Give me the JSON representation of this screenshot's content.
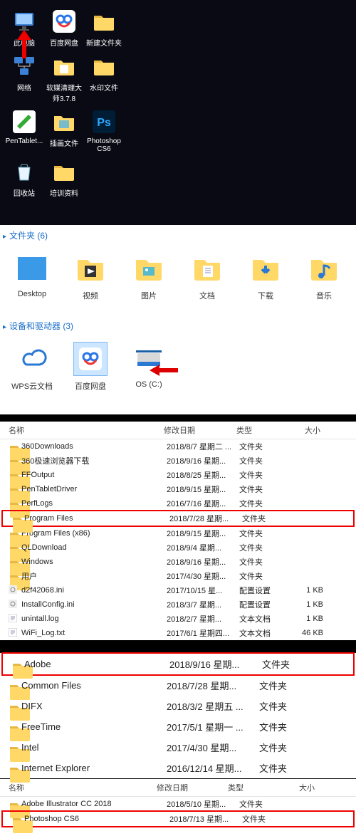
{
  "desktop": {
    "rows": [
      [
        {
          "label": "此电脑",
          "icon": "monitor",
          "name": "desktop-icon-this-pc"
        },
        {
          "label": "百度网盘",
          "icon": "baidu",
          "name": "desktop-icon-baidu-netdisk"
        },
        {
          "label": "新建文件夹",
          "icon": "folder",
          "name": "desktop-icon-new-folder"
        }
      ],
      [
        {
          "label": "网络",
          "icon": "network",
          "name": "desktop-icon-network"
        },
        {
          "label": "软媒清理大师3.7.8",
          "icon": "folder-doc",
          "name": "desktop-icon-cleaner"
        },
        {
          "label": "水印文件",
          "icon": "folder",
          "name": "desktop-icon-watermark"
        }
      ],
      [
        {
          "label": "PenTablet...",
          "icon": "app-green",
          "name": "desktop-icon-pentablet"
        },
        {
          "label": "插画文件",
          "icon": "folder-pic",
          "name": "desktop-icon-illustration"
        },
        {
          "label": "Photoshop CS6",
          "icon": "ps",
          "name": "desktop-icon-photoshop"
        }
      ],
      [
        {
          "label": "回收站",
          "icon": "recycle",
          "name": "desktop-icon-recycle-bin"
        },
        {
          "label": "培训资料",
          "icon": "folder",
          "name": "desktop-icon-training"
        }
      ]
    ]
  },
  "folders_section": {
    "title": "文件夹 (6)",
    "items": [
      {
        "label": "Desktop",
        "icon": "desktop-tile",
        "name": "library-desktop"
      },
      {
        "label": "视频",
        "icon": "video",
        "name": "library-videos"
      },
      {
        "label": "图片",
        "icon": "pictures",
        "name": "library-pictures"
      },
      {
        "label": "文档",
        "icon": "documents",
        "name": "library-documents"
      },
      {
        "label": "下载",
        "icon": "downloads",
        "name": "library-downloads"
      },
      {
        "label": "音乐",
        "icon": "music",
        "name": "library-music"
      }
    ]
  },
  "drives_section": {
    "title": "设备和驱动器 (3)",
    "items": [
      {
        "label": "WPS云文档",
        "icon": "wps-cloud",
        "name": "drive-wps-cloud"
      },
      {
        "label": "百度网盘",
        "icon": "baidu",
        "name": "drive-baidu",
        "selected": true
      },
      {
        "label": "OS (C:)",
        "icon": "hdd",
        "name": "drive-os-c"
      }
    ]
  },
  "table1": {
    "headers": {
      "name": "名称",
      "date": "修改日期",
      "type": "类型",
      "size": "大小"
    },
    "rows": [
      {
        "name": "360Downloads",
        "date": "2018/8/7 星期二 ...",
        "type": "文件夹",
        "size": "",
        "icon": "folder",
        "dn": "row-360downloads"
      },
      {
        "name": "360极速浏览器下载",
        "date": "2018/9/16 星期...",
        "type": "文件夹",
        "size": "",
        "icon": "folder",
        "dn": "row-360browser"
      },
      {
        "name": "FFOutput",
        "date": "2018/8/25 星期...",
        "type": "文件夹",
        "size": "",
        "icon": "folder",
        "dn": "row-ffoutput"
      },
      {
        "name": "PenTabletDriver",
        "date": "2018/9/15 星期...",
        "type": "文件夹",
        "size": "",
        "icon": "folder",
        "dn": "row-pentabletdriver"
      },
      {
        "name": "PerfLogs",
        "date": "2016/7/16 星期...",
        "type": "文件夹",
        "size": "",
        "icon": "folder",
        "dn": "row-perflogs"
      },
      {
        "name": "Program Files",
        "date": "2018/7/28 星期...",
        "type": "文件夹",
        "size": "",
        "icon": "folder",
        "highlight": true,
        "dn": "row-program-files"
      },
      {
        "name": "Program Files (x86)",
        "date": "2018/9/15 星期...",
        "type": "文件夹",
        "size": "",
        "icon": "folder",
        "dn": "row-program-files-x86"
      },
      {
        "name": "QLDownload",
        "date": "2018/9/4 星期...",
        "type": "文件夹",
        "size": "",
        "icon": "folder",
        "dn": "row-qldownload"
      },
      {
        "name": "Windows",
        "date": "2018/9/16 星期...",
        "type": "文件夹",
        "size": "",
        "icon": "folder",
        "dn": "row-windows"
      },
      {
        "name": "用户",
        "date": "2017/4/30 星期...",
        "type": "文件夹",
        "size": "",
        "icon": "folder",
        "dn": "row-users"
      },
      {
        "name": "d2f42068.ini",
        "date": "2017/10/15 星...",
        "type": "配置设置",
        "size": "1 KB",
        "icon": "ini",
        "dn": "row-d2f42068"
      },
      {
        "name": "InstallConfig.ini",
        "date": "2018/3/7 星期...",
        "type": "配置设置",
        "size": "1 KB",
        "icon": "ini",
        "dn": "row-installconfig"
      },
      {
        "name": "unintall.log",
        "date": "2018/2/7 星期...",
        "type": "文本文档",
        "size": "1 KB",
        "icon": "txt",
        "dn": "row-uninstall-log"
      },
      {
        "name": "WiFi_Log.txt",
        "date": "2017/6/1 星期四...",
        "type": "文本文档",
        "size": "46 KB",
        "icon": "txt",
        "dn": "row-wifi-log"
      }
    ]
  },
  "table2": {
    "rows": [
      {
        "name": "Adobe",
        "date": "2018/9/16 星期...",
        "type": "文件夹",
        "highlight": true,
        "dn": "row-adobe"
      },
      {
        "name": "Common Files",
        "date": "2018/7/28 星期...",
        "type": "文件夹",
        "dn": "row-common-files"
      },
      {
        "name": "DIFX",
        "date": "2018/3/2 星期五 ...",
        "type": "文件夹",
        "dn": "row-difx"
      },
      {
        "name": "FreeTime",
        "date": "2017/5/1 星期一 ...",
        "type": "文件夹",
        "dn": "row-freetime"
      },
      {
        "name": "Intel",
        "date": "2017/4/30 星期...",
        "type": "文件夹",
        "dn": "row-intel"
      },
      {
        "name": "Internet Explorer",
        "date": "2016/12/14 星期...",
        "type": "文件夹",
        "dn": "row-ie"
      }
    ]
  },
  "table3": {
    "headers": {
      "name": "名称",
      "date": "修改日期",
      "type": "类型",
      "size": "大小"
    },
    "rows": [
      {
        "name": "Adobe Illustrator CC 2018",
        "date": "2018/5/10 星期...",
        "type": "文件夹",
        "dn": "row-illustrator"
      },
      {
        "name": "Photoshop CS6",
        "date": "2018/7/13 星期...",
        "type": "文件夹",
        "highlight": true,
        "dn": "row-photoshop-cs6"
      }
    ]
  }
}
